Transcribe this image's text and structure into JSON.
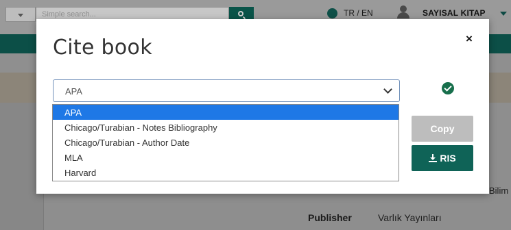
{
  "background": {
    "search_placeholder": "Simple search...",
    "lang_switch": "TR / EN",
    "user_name": "SAYISAL KITAP",
    "content_fragment": "Bilim",
    "publisher_label": "Publisher",
    "publisher_value": "Varlık Yayınları"
  },
  "modal": {
    "title": "Cite book",
    "close_label": "×",
    "selected_style": "APA",
    "style_options": [
      "APA",
      "Chicago/Turabian - Notes Bibliography",
      "Chicago/Turabian - Author Date",
      "MLA",
      "Harvard"
    ],
    "copy_label": "Copy",
    "ris_label": "RIS"
  },
  "colors": {
    "accent_teal": "#0f6357",
    "selected_option": "#1e78e6",
    "success_green": "#176f4c",
    "copy_disabled": "#bdbdbd"
  },
  "icons": {
    "search": "search-icon",
    "globe": "globe-icon",
    "user": "user-icon",
    "check": "check-circle-icon",
    "download": "download-icon",
    "close": "close-icon",
    "chevron": "chevron-down-icon"
  }
}
